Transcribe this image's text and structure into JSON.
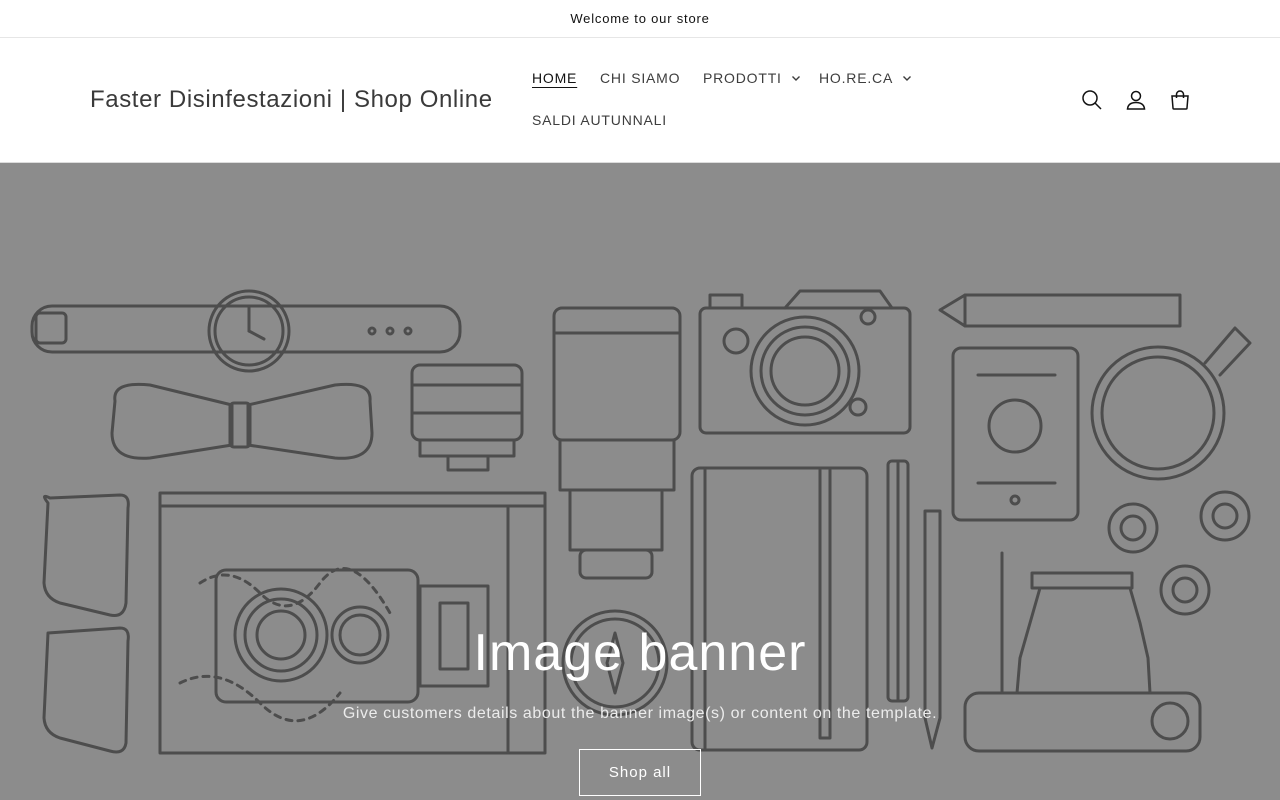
{
  "announcement": {
    "text": "Welcome to our store"
  },
  "header": {
    "logo": "Faster Disinfestazioni | Shop Online",
    "nav": [
      {
        "label": "HOME",
        "active": true,
        "dropdown": false
      },
      {
        "label": "CHI SIAMO",
        "active": false,
        "dropdown": false
      },
      {
        "label": "PRODOTTI",
        "active": false,
        "dropdown": true
      },
      {
        "label": "HO.RE.CA",
        "active": false,
        "dropdown": true
      },
      {
        "label": "SALDI AUTUNNALI",
        "active": false,
        "dropdown": false
      }
    ],
    "icons": [
      "search-icon",
      "account-icon",
      "cart-icon"
    ]
  },
  "banner": {
    "title": "Image banner",
    "text": "Give customers details about the banner image(s) or content on the template.",
    "button_label": "Shop all",
    "background_color": "#8c8c8c",
    "line_color": "#4d4d4d"
  }
}
